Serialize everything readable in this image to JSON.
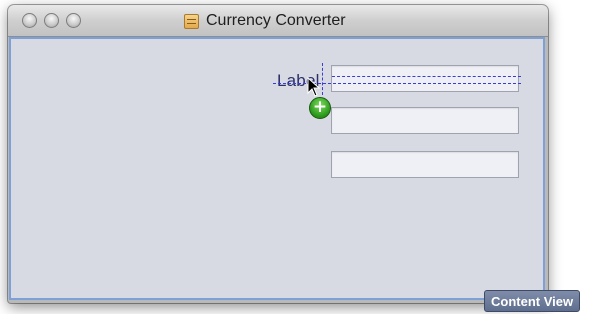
{
  "window": {
    "title": "Currency Converter",
    "icon": "document-icon",
    "traffic_lights": [
      "close-button",
      "minimize-button",
      "zoom-button"
    ]
  },
  "canvas": {
    "dragged_label_text": "Label",
    "text_fields": [
      {
        "value": ""
      },
      {
        "value": ""
      },
      {
        "value": ""
      }
    ],
    "drag_badge_icon": "plus-icon",
    "cursor_icon": "arrow-cursor-icon"
  },
  "tooltip": {
    "text": "Content View"
  },
  "colors": {
    "content_background": "#d7dae2",
    "content_border": "#7da0d6",
    "guide_color": "#3b3bd8",
    "badge_green": "#2c9b1c",
    "tooltip_bg": "#6b7898"
  }
}
